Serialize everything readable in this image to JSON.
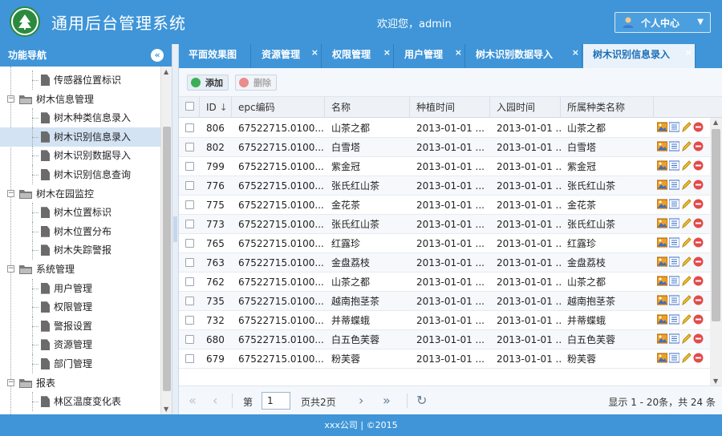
{
  "header": {
    "title": "通用后台管理系统",
    "welcome_prefix": "欢迎您，",
    "username": "admin",
    "user_menu_label": "个人中心",
    "logo_icon": "tree-logo-icon",
    "user_icon": "person-icon",
    "caret_icon": "caret-down-icon"
  },
  "sidebar": {
    "title": "功能导航",
    "collapse_icon": "chevron-left-circle-icon",
    "items": [
      {
        "label": "传感器位置标识",
        "level": 2,
        "type": "leaf"
      },
      {
        "label": "树木信息管理",
        "level": 1,
        "type": "folder"
      },
      {
        "label": "树木种类信息录入",
        "level": 2,
        "type": "leaf"
      },
      {
        "label": "树木识别信息录入",
        "level": 2,
        "type": "leaf",
        "selected": true
      },
      {
        "label": "树木识别数据导入",
        "level": 2,
        "type": "leaf"
      },
      {
        "label": "树木识别信息查询",
        "level": 2,
        "type": "leaf"
      },
      {
        "label": "树木在园监控",
        "level": 1,
        "type": "folder"
      },
      {
        "label": "树木位置标识",
        "level": 2,
        "type": "leaf"
      },
      {
        "label": "树木位置分布",
        "level": 2,
        "type": "leaf"
      },
      {
        "label": "树木失踪警报",
        "level": 2,
        "type": "leaf"
      },
      {
        "label": "系统管理",
        "level": 1,
        "type": "folder"
      },
      {
        "label": "用户管理",
        "level": 2,
        "type": "leaf"
      },
      {
        "label": "权限管理",
        "level": 2,
        "type": "leaf"
      },
      {
        "label": "警报设置",
        "level": 2,
        "type": "leaf"
      },
      {
        "label": "资源管理",
        "level": 2,
        "type": "leaf"
      },
      {
        "label": "部门管理",
        "level": 2,
        "type": "leaf"
      },
      {
        "label": "报表",
        "level": 1,
        "type": "folder"
      },
      {
        "label": "林区温度变化表",
        "level": 2,
        "type": "leaf"
      }
    ]
  },
  "tabs": [
    {
      "label": "平面效果图",
      "closable": false
    },
    {
      "label": "资源管理",
      "closable": true
    },
    {
      "label": "权限管理",
      "closable": true
    },
    {
      "label": "用户管理",
      "closable": true
    },
    {
      "label": "树木识别数据导入",
      "closable": true
    },
    {
      "label": "树木识别信息录入",
      "closable": true,
      "active": true
    }
  ],
  "toolbar": {
    "add_label": "添加",
    "delete_label": "删除"
  },
  "grid": {
    "columns": [
      "ID",
      "epc编码",
      "名称",
      "种植时间",
      "入园时间",
      "所属种类名称"
    ],
    "sort_icon": "arrow-down-icon",
    "rows": [
      {
        "id": "806",
        "epc": "67522715.0100...",
        "name": "山茶之都",
        "plant": "2013-01-01 ...",
        "enter": "2013-01-01 ...",
        "kind": "山茶之都"
      },
      {
        "id": "802",
        "epc": "67522715.0100...",
        "name": "白雪塔",
        "plant": "2013-01-01 ...",
        "enter": "2013-01-01 ...",
        "kind": "白雪塔"
      },
      {
        "id": "799",
        "epc": "67522715.0100...",
        "name": "紫金冠",
        "plant": "2013-01-01 ...",
        "enter": "2013-01-01 ...",
        "kind": "紫金冠"
      },
      {
        "id": "776",
        "epc": "67522715.0100...",
        "name": "张氏红山茶",
        "plant": "2013-01-01 ...",
        "enter": "2013-01-01 ...",
        "kind": "张氏红山茶"
      },
      {
        "id": "775",
        "epc": "67522715.0100...",
        "name": "金花茶",
        "plant": "2013-01-01 ...",
        "enter": "2013-01-01 ...",
        "kind": "金花茶"
      },
      {
        "id": "773",
        "epc": "67522715.0100...",
        "name": "张氏红山茶",
        "plant": "2013-01-01 ...",
        "enter": "2013-01-01 ...",
        "kind": "张氏红山茶"
      },
      {
        "id": "765",
        "epc": "67522715.0100...",
        "name": "红露珍",
        "plant": "2013-01-01 ...",
        "enter": "2013-01-01 ...",
        "kind": "红露珍"
      },
      {
        "id": "763",
        "epc": "67522715.0100...",
        "name": "金盘荔枝",
        "plant": "2013-01-01 ...",
        "enter": "2013-01-01 ...",
        "kind": "金盘荔枝"
      },
      {
        "id": "762",
        "epc": "67522715.0100...",
        "name": "山茶之都",
        "plant": "2013-01-01 ...",
        "enter": "2013-01-01 ...",
        "kind": "山茶之都"
      },
      {
        "id": "735",
        "epc": "67522715.0100...",
        "name": "越南抱茎茶",
        "plant": "2013-01-01 ...",
        "enter": "2013-01-01 ...",
        "kind": "越南抱茎茶"
      },
      {
        "id": "732",
        "epc": "67522715.0100...",
        "name": "并蒂蝶蛾",
        "plant": "2013-01-01 ...",
        "enter": "2013-01-01 ...",
        "kind": "并蒂蝶蛾"
      },
      {
        "id": "680",
        "epc": "67522715.0100...",
        "name": "白五色芙蓉",
        "plant": "2013-01-01 ...",
        "enter": "2013-01-01 ...",
        "kind": "白五色芙蓉"
      },
      {
        "id": "679",
        "epc": "67522715.0100...",
        "name": "粉芙蓉",
        "plant": "2013-01-01 ...",
        "enter": "2013-01-01 ...",
        "kind": "粉芙蓉"
      }
    ],
    "row_action_icons": [
      "image-icon",
      "list-icon",
      "edit-pencil-icon",
      "delete-icon"
    ]
  },
  "pager": {
    "page_prefix": "第",
    "current_page": "1",
    "page_suffix": "页共2页",
    "info": "显示 1 - 20条，共 24 条"
  },
  "footer": {
    "text": "xxx公司 |  ©2015"
  },
  "colors": {
    "primary": "#3f95d8",
    "selected_row": "#d3e3f4",
    "logo_green": "#2b8a3e"
  }
}
